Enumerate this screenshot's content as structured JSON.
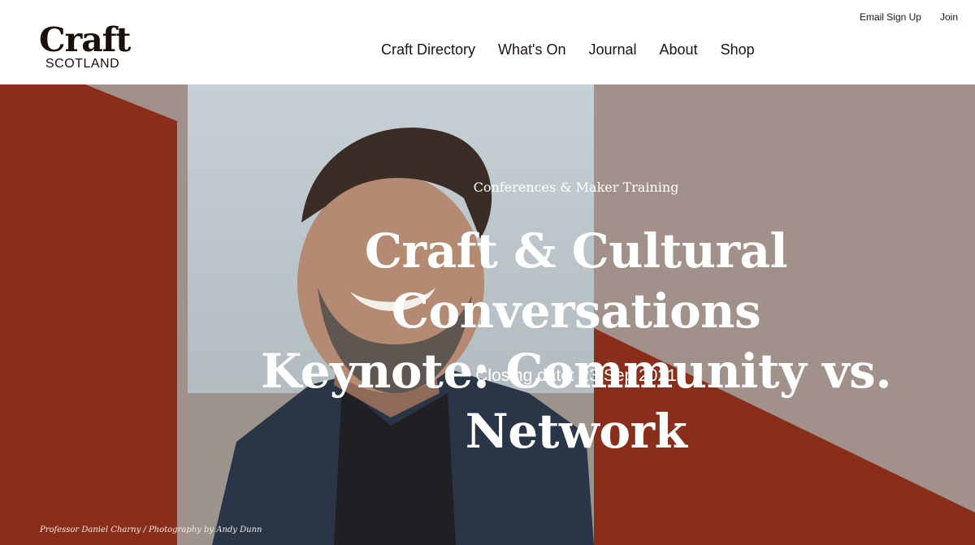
{
  "brand": {
    "logo_top": "Craft",
    "logo_bottom": "SCOTLAND"
  },
  "utility_nav": [
    {
      "label": "Email Sign Up"
    },
    {
      "label": "Join"
    }
  ],
  "main_nav": [
    {
      "label": "Craft Directory"
    },
    {
      "label": "What's On"
    },
    {
      "label": "Journal"
    },
    {
      "label": "About"
    },
    {
      "label": "Shop"
    }
  ],
  "hero": {
    "category": "Conferences & Maker Training",
    "title_line1": "Craft & Cultural Conversations",
    "title_line2": "Keynote: Community vs. Network",
    "closing_label": "Closing date:",
    "closing_date": "23 Sep 2021",
    "caption": "Professor Daniel Charny / Photography by Andy Dunn"
  },
  "colors": {
    "rust": "#8a2e1c",
    "taupe": "#a1918a",
    "photo_sky": "#bcc8cf",
    "jacket": "#28354a",
    "white": "#ffffff"
  }
}
